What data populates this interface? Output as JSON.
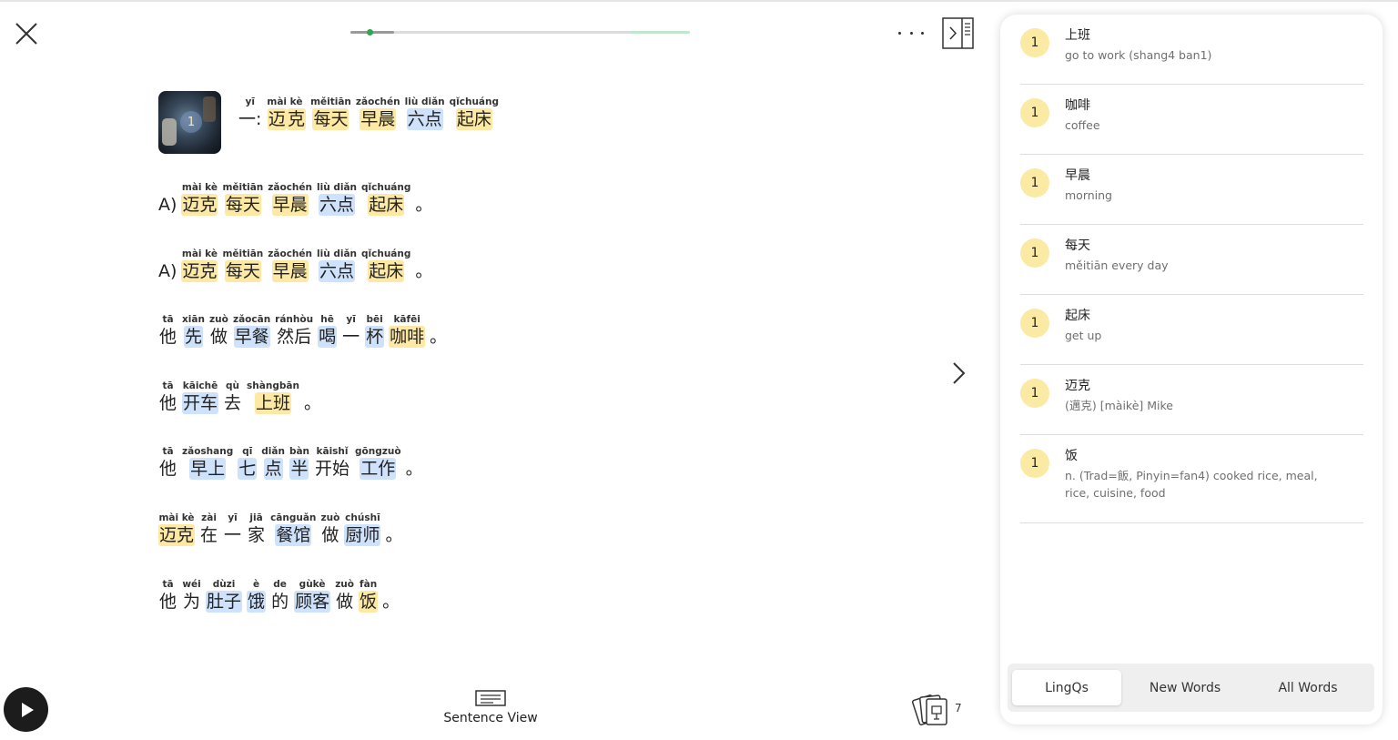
{
  "progress": {
    "fraction": 0.13
  },
  "lesson": {
    "thumbnail_badge": "1",
    "title": [
      {
        "py": "yī",
        "hz": "一:",
        "c": "plain"
      },
      {
        "py": "mài",
        "hz": "迈",
        "c": "yellow",
        "join": true
      },
      {
        "py": "kè",
        "hz": "克",
        "c": "yellow"
      },
      {
        "py": "měitiān",
        "hz": "每天",
        "c": "yellow"
      },
      {
        "py": "zǎochén",
        "hz": "早晨",
        "c": "yellow"
      },
      {
        "py": "liù diǎn",
        "hz": "六点",
        "c": "blue"
      },
      {
        "py": "qǐchuáng",
        "hz": "起床",
        "c": "yellow"
      }
    ],
    "sentences": [
      [
        {
          "py": "",
          "hz": "A)",
          "c": "plain"
        },
        {
          "py": "mài kè",
          "hz": "迈克",
          "c": "yellow"
        },
        {
          "py": "měitiān",
          "hz": "每天",
          "c": "yellow"
        },
        {
          "py": "zǎochén",
          "hz": "早晨",
          "c": "yellow"
        },
        {
          "py": "liù diǎn",
          "hz": "六点",
          "c": "blue"
        },
        {
          "py": "qǐchuáng",
          "hz": "起床",
          "c": "yellow"
        },
        {
          "py": "",
          "hz": "。",
          "c": "plain"
        }
      ],
      [
        {
          "py": "",
          "hz": "A)",
          "c": "plain"
        },
        {
          "py": "mài kè",
          "hz": "迈克",
          "c": "yellow"
        },
        {
          "py": "měitiān",
          "hz": "每天",
          "c": "yellow"
        },
        {
          "py": "zǎochén",
          "hz": "早晨",
          "c": "yellow"
        },
        {
          "py": "liù diǎn",
          "hz": "六点",
          "c": "blue"
        },
        {
          "py": "qǐchuáng",
          "hz": "起床",
          "c": "yellow"
        },
        {
          "py": "",
          "hz": "。",
          "c": "plain"
        }
      ],
      [
        {
          "py": "tā",
          "hz": "他",
          "c": "plain"
        },
        {
          "py": "xiān",
          "hz": "先",
          "c": "blue"
        },
        {
          "py": "zuò",
          "hz": "做",
          "c": "plain"
        },
        {
          "py": "zǎocān",
          "hz": "早餐",
          "c": "blue"
        },
        {
          "py": "ránhòu",
          "hz": "然后",
          "c": "plain"
        },
        {
          "py": "hē",
          "hz": "喝",
          "c": "blue"
        },
        {
          "py": "yī",
          "hz": "一",
          "c": "plain"
        },
        {
          "py": "bēi",
          "hz": "杯",
          "c": "blue"
        },
        {
          "py": "kāfēi",
          "hz": "咖啡",
          "c": "yellow"
        },
        {
          "py": "",
          "hz": "。",
          "c": "plain"
        }
      ],
      [
        {
          "py": "tā",
          "hz": "他",
          "c": "plain"
        },
        {
          "py": "kāichē",
          "hz": "开车",
          "c": "blue"
        },
        {
          "py": "qù",
          "hz": "去",
          "c": "plain"
        },
        {
          "py": "shàngbān",
          "hz": "上班",
          "c": "yellow"
        },
        {
          "py": "",
          "hz": "。",
          "c": "plain"
        }
      ],
      [
        {
          "py": "tā",
          "hz": "他",
          "c": "plain"
        },
        {
          "py": "zǎoshang",
          "hz": "早上",
          "c": "blue"
        },
        {
          "py": "qī",
          "hz": "七",
          "c": "blue"
        },
        {
          "py": "diǎn",
          "hz": "点",
          "c": "blue"
        },
        {
          "py": "bàn",
          "hz": "半",
          "c": "blue"
        },
        {
          "py": "kāishǐ",
          "hz": "开始",
          "c": "plain"
        },
        {
          "py": "gōngzuò",
          "hz": "工作",
          "c": "blue"
        },
        {
          "py": "",
          "hz": "。",
          "c": "plain"
        }
      ],
      [
        {
          "py": "mài kè",
          "hz": "迈克",
          "c": "yellow"
        },
        {
          "py": "zài",
          "hz": "在",
          "c": "plain"
        },
        {
          "py": "yī",
          "hz": "一",
          "c": "plain"
        },
        {
          "py": "jiā",
          "hz": "家",
          "c": "plain"
        },
        {
          "py": "cānguǎn",
          "hz": "餐馆",
          "c": "blue"
        },
        {
          "py": "zuò",
          "hz": "做",
          "c": "plain"
        },
        {
          "py": "chúshī",
          "hz": "厨师",
          "c": "blue"
        },
        {
          "py": "",
          "hz": "。",
          "c": "plain"
        }
      ],
      [
        {
          "py": "tā",
          "hz": "他",
          "c": "plain"
        },
        {
          "py": "wéi",
          "hz": "为",
          "c": "plain"
        },
        {
          "py": "dùzi",
          "hz": "肚子",
          "c": "blue"
        },
        {
          "py": "è",
          "hz": "饿",
          "c": "blue"
        },
        {
          "py": "de",
          "hz": "的",
          "c": "plain"
        },
        {
          "py": "gùkè",
          "hz": "顾客",
          "c": "blue"
        },
        {
          "py": "zuò",
          "hz": "做",
          "c": "plain"
        },
        {
          "py": "fàn",
          "hz": "饭",
          "c": "yellow"
        },
        {
          "py": "",
          "hz": "。",
          "c": "plain"
        }
      ]
    ]
  },
  "bottom": {
    "sentence_view_label": "Sentence View",
    "cards_count": "7"
  },
  "panel": {
    "lingqs": [
      {
        "status": "1",
        "term": "上班",
        "hint": "go to work (shang4 ban1)"
      },
      {
        "status": "1",
        "term": "咖啡",
        "hint": "coffee"
      },
      {
        "status": "1",
        "term": "早晨",
        "hint": "morning"
      },
      {
        "status": "1",
        "term": "每天",
        "hint": "měitiān every day"
      },
      {
        "status": "1",
        "term": "起床",
        "hint": "get up"
      },
      {
        "status": "1",
        "term": "迈克",
        "hint": "(邁克) [màikè] Mike"
      },
      {
        "status": "1",
        "term": "饭",
        "hint": "n. (Trad=飯, Pinyin=fan4) cooked rice, meal, rice, cuisine, food"
      }
    ],
    "tabs": [
      {
        "label": "LingQs",
        "active": true
      },
      {
        "label": "New Words",
        "active": false
      },
      {
        "label": "All Words",
        "active": false
      }
    ]
  },
  "colors": {
    "known_highlight": "#fde9a3",
    "new_highlight": "#cfe2fb",
    "progress_dot": "#2ea84f"
  },
  "icons": [
    "close-icon",
    "more-icon",
    "panel-toggle-icon",
    "chevron-right-icon",
    "play-icon",
    "sentence-view-icon",
    "flashcards-icon"
  ]
}
